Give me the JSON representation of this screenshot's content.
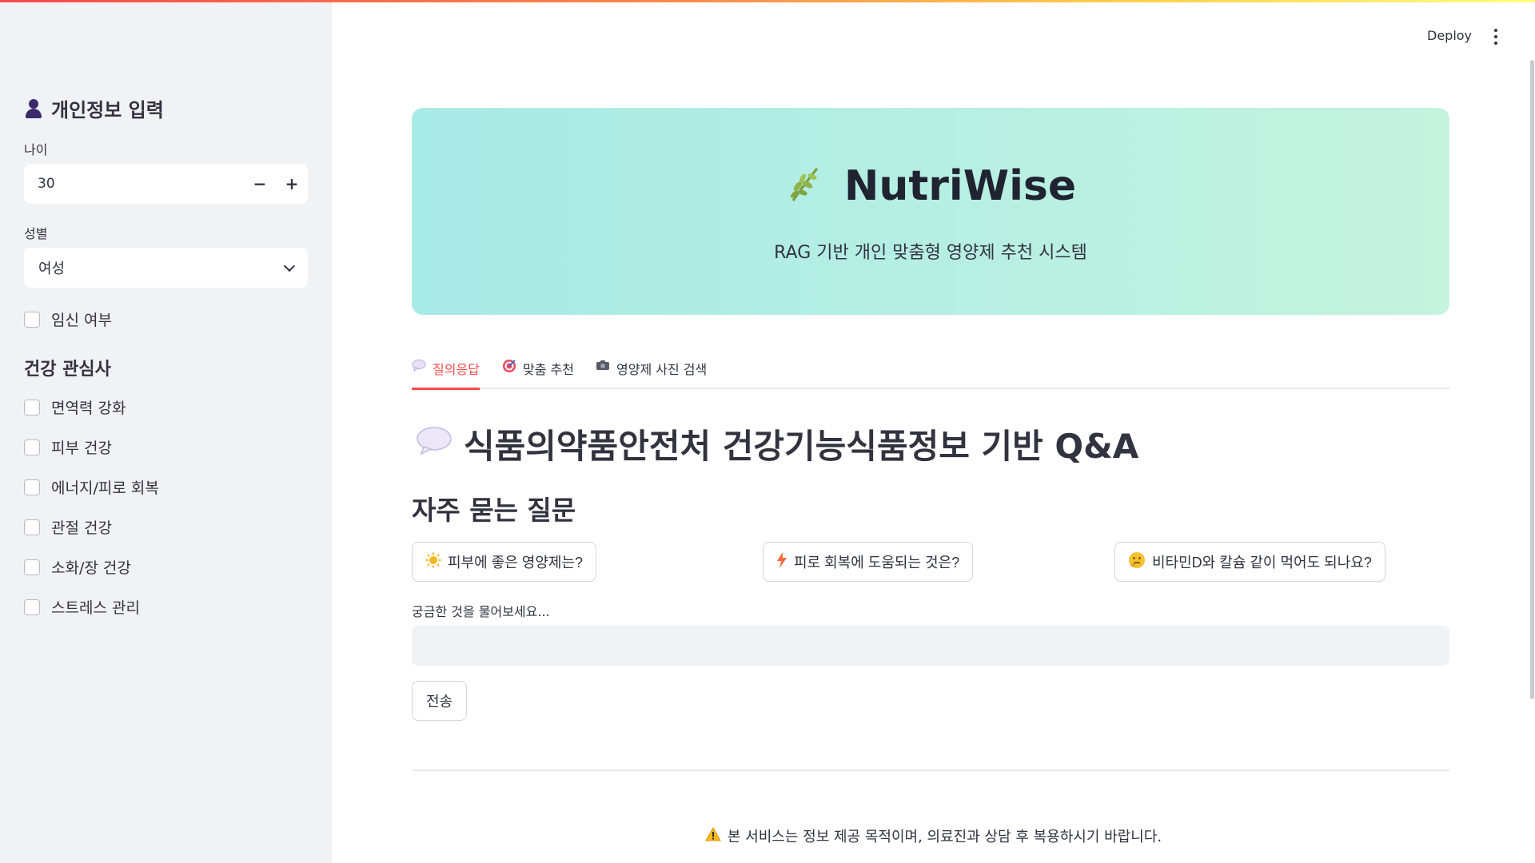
{
  "top_actions": {
    "deploy_label": "Deploy"
  },
  "sidebar": {
    "title": "개인정보 입력",
    "age": {
      "label": "나이",
      "value": "30",
      "minus": "−",
      "plus": "+"
    },
    "gender": {
      "label": "성별",
      "value": "여성"
    },
    "pregnant": {
      "label": "임신 여부",
      "checked": false
    },
    "interests_title": "건강 관심사",
    "interests": [
      {
        "label": "면역력 강화",
        "checked": false
      },
      {
        "label": "피부 건강",
        "checked": false
      },
      {
        "label": "에너지/피로 회복",
        "checked": false
      },
      {
        "label": "관절 건강",
        "checked": false
      },
      {
        "label": "소화/장 건강",
        "checked": false
      },
      {
        "label": "스트레스 관리",
        "checked": false
      }
    ]
  },
  "hero": {
    "title": "NutriWise",
    "subtitle": "RAG 기반 개인 맞춤형 영양제 추천 시스템",
    "icon": "herb-icon"
  },
  "tabs": [
    {
      "label": "질의응답",
      "icon": "speech-bubble-icon",
      "active": true
    },
    {
      "label": "맞춤 추천",
      "icon": "target-icon",
      "active": false
    },
    {
      "label": "영양제 사진 검색",
      "icon": "camera-icon",
      "active": false
    }
  ],
  "main": {
    "heading": "식품의약품안전처 건강기능식품정보 기반 Q&A",
    "faq_title": "자주 묻는 질문",
    "faq": [
      {
        "label": "피부에 좋은 영양제는?",
        "icon": "sun-icon"
      },
      {
        "label": "피로 회복에 도움되는 것은?",
        "icon": "lightning-icon"
      },
      {
        "label": "비타민D와 칼슘 같이 먹어도 되나요?",
        "icon": "thinking-face-icon"
      }
    ],
    "question_label": "궁금한 것을 물어보세요...",
    "question_value": "",
    "send_label": "전송"
  },
  "footer": {
    "notice": "본 서비스는 정보 제공 목적이며, 의료진과 상담 후 복용하시기 바랍니다."
  },
  "colors": {
    "accent": "#ff4b4b",
    "sidebar_bg": "#f0f2f6",
    "hero_start": "#a8eae6",
    "hero_end": "#c4f3de"
  }
}
